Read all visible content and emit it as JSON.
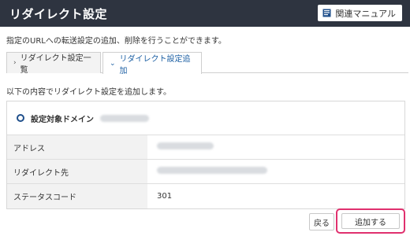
{
  "header": {
    "title": "リダイレクト設定",
    "manual_label": "関連マニュアル",
    "manual_icon": "book-icon"
  },
  "description": "指定のURLへの転送設定の追加、削除を行うことができます。",
  "tabs": [
    {
      "label": "リダイレクト設定一覧",
      "icon": "chevron-right-icon",
      "active": false
    },
    {
      "label": "リダイレクト設定追加",
      "icon": "chevron-down-icon",
      "active": true
    }
  ],
  "intro": "以下の内容でリダイレクト設定を追加します。",
  "form": {
    "domain_label": "設定対象ドメイン",
    "rows": [
      {
        "key": "アドレス",
        "value": ""
      },
      {
        "key": "リダイレクト先",
        "value": ""
      },
      {
        "key": "ステータスコード",
        "value": "301"
      }
    ]
  },
  "buttons": {
    "back": "戻る",
    "add": "追加する"
  },
  "colors": {
    "header_bg": "#2e3440",
    "active_tab_text": "#1c5fa3",
    "highlight": "#e0306e"
  }
}
